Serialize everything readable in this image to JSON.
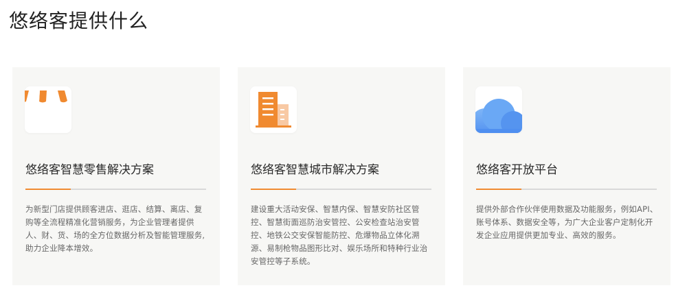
{
  "page": {
    "title": "悠络客提供什么"
  },
  "colors": {
    "accent": "#f08a30",
    "card_bg": "#f7f7f5",
    "divider": "#d9d9d9",
    "icon_blue": "#5b9cf0"
  },
  "cards": [
    {
      "icon": "storefront-icon",
      "title": "悠络客智慧零售解决方案",
      "description": "为新型门店提供顾客进店、逛店、结算、离店、复购等全流程精准化营销服务，为企业管理者提供人、财、货、场的全方位数据分析及智能管理服务,助力企业降本增效。"
    },
    {
      "icon": "building-icon",
      "title": "悠络客智慧城市解决方案",
      "description": "建设重大活动安保、智慧内保、智慧安防社区管控、智慧街面巡防治安管控、公安检查站治安管控、地铁公交安保智能防控、危爆物品立体化溯源、易制枪物品图形比对、娱乐场所和特种行业治安管控等子系统。"
    },
    {
      "icon": "cloud-icon",
      "title": "悠络客开放平台",
      "description": "提供外部合作伙伴使用数据及功能服务，例如API、账号体系、数据安全等，为广大企业客户定制化开发企业应用提供更加专业、高效的服务。"
    }
  ]
}
